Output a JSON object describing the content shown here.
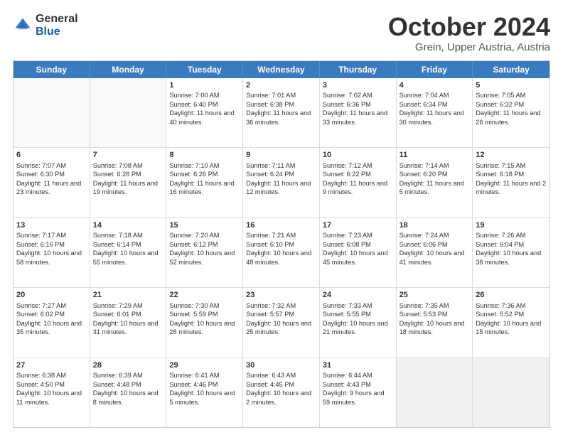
{
  "logo": {
    "general": "General",
    "blue": "Blue"
  },
  "header": {
    "month": "October 2024",
    "location": "Grein, Upper Austria, Austria"
  },
  "weekdays": [
    "Sunday",
    "Monday",
    "Tuesday",
    "Wednesday",
    "Thursday",
    "Friday",
    "Saturday"
  ],
  "rows": [
    [
      {
        "day": "",
        "content": "",
        "empty": true
      },
      {
        "day": "",
        "content": "",
        "empty": true
      },
      {
        "day": "1",
        "content": "Sunrise: 7:00 AM\nSunset: 6:40 PM\nDaylight: 11 hours and 40 minutes."
      },
      {
        "day": "2",
        "content": "Sunrise: 7:01 AM\nSunset: 6:38 PM\nDaylight: 11 hours and 36 minutes."
      },
      {
        "day": "3",
        "content": "Sunrise: 7:02 AM\nSunset: 6:36 PM\nDaylight: 11 hours and 33 minutes."
      },
      {
        "day": "4",
        "content": "Sunrise: 7:04 AM\nSunset: 6:34 PM\nDaylight: 11 hours and 30 minutes."
      },
      {
        "day": "5",
        "content": "Sunrise: 7:05 AM\nSunset: 6:32 PM\nDaylight: 11 hours and 26 minutes."
      }
    ],
    [
      {
        "day": "6",
        "content": "Sunrise: 7:07 AM\nSunset: 6:30 PM\nDaylight: 11 hours and 23 minutes."
      },
      {
        "day": "7",
        "content": "Sunrise: 7:08 AM\nSunset: 6:28 PM\nDaylight: 11 hours and 19 minutes."
      },
      {
        "day": "8",
        "content": "Sunrise: 7:10 AM\nSunset: 6:26 PM\nDaylight: 11 hours and 16 minutes."
      },
      {
        "day": "9",
        "content": "Sunrise: 7:11 AM\nSunset: 6:24 PM\nDaylight: 11 hours and 12 minutes."
      },
      {
        "day": "10",
        "content": "Sunrise: 7:12 AM\nSunset: 6:22 PM\nDaylight: 11 hours and 9 minutes."
      },
      {
        "day": "11",
        "content": "Sunrise: 7:14 AM\nSunset: 6:20 PM\nDaylight: 11 hours and 5 minutes."
      },
      {
        "day": "12",
        "content": "Sunrise: 7:15 AM\nSunset: 6:18 PM\nDaylight: 11 hours and 2 minutes."
      }
    ],
    [
      {
        "day": "13",
        "content": "Sunrise: 7:17 AM\nSunset: 6:16 PM\nDaylight: 10 hours and 58 minutes."
      },
      {
        "day": "14",
        "content": "Sunrise: 7:18 AM\nSunset: 6:14 PM\nDaylight: 10 hours and 55 minutes."
      },
      {
        "day": "15",
        "content": "Sunrise: 7:20 AM\nSunset: 6:12 PM\nDaylight: 10 hours and 52 minutes."
      },
      {
        "day": "16",
        "content": "Sunrise: 7:21 AM\nSunset: 6:10 PM\nDaylight: 10 hours and 48 minutes."
      },
      {
        "day": "17",
        "content": "Sunrise: 7:23 AM\nSunset: 6:08 PM\nDaylight: 10 hours and 45 minutes."
      },
      {
        "day": "18",
        "content": "Sunrise: 7:24 AM\nSunset: 6:06 PM\nDaylight: 10 hours and 41 minutes."
      },
      {
        "day": "19",
        "content": "Sunrise: 7:26 AM\nSunset: 6:04 PM\nDaylight: 10 hours and 38 minutes."
      }
    ],
    [
      {
        "day": "20",
        "content": "Sunrise: 7:27 AM\nSunset: 6:02 PM\nDaylight: 10 hours and 35 minutes."
      },
      {
        "day": "21",
        "content": "Sunrise: 7:29 AM\nSunset: 6:01 PM\nDaylight: 10 hours and 31 minutes."
      },
      {
        "day": "22",
        "content": "Sunrise: 7:30 AM\nSunset: 5:59 PM\nDaylight: 10 hours and 28 minutes."
      },
      {
        "day": "23",
        "content": "Sunrise: 7:32 AM\nSunset: 5:57 PM\nDaylight: 10 hours and 25 minutes."
      },
      {
        "day": "24",
        "content": "Sunrise: 7:33 AM\nSunset: 5:55 PM\nDaylight: 10 hours and 21 minutes."
      },
      {
        "day": "25",
        "content": "Sunrise: 7:35 AM\nSunset: 5:53 PM\nDaylight: 10 hours and 18 minutes."
      },
      {
        "day": "26",
        "content": "Sunrise: 7:36 AM\nSunset: 5:52 PM\nDaylight: 10 hours and 15 minutes."
      }
    ],
    [
      {
        "day": "27",
        "content": "Sunrise: 6:38 AM\nSunset: 4:50 PM\nDaylight: 10 hours and 11 minutes."
      },
      {
        "day": "28",
        "content": "Sunrise: 6:39 AM\nSunset: 4:48 PM\nDaylight: 10 hours and 8 minutes."
      },
      {
        "day": "29",
        "content": "Sunrise: 6:41 AM\nSunset: 4:46 PM\nDaylight: 10 hours and 5 minutes."
      },
      {
        "day": "30",
        "content": "Sunrise: 6:43 AM\nSunset: 4:45 PM\nDaylight: 10 hours and 2 minutes."
      },
      {
        "day": "31",
        "content": "Sunrise: 6:44 AM\nSunset: 4:43 PM\nDaylight: 9 hours and 59 minutes."
      },
      {
        "day": "",
        "content": "",
        "empty": true,
        "shaded": true
      },
      {
        "day": "",
        "content": "",
        "empty": true,
        "shaded": true
      }
    ]
  ]
}
